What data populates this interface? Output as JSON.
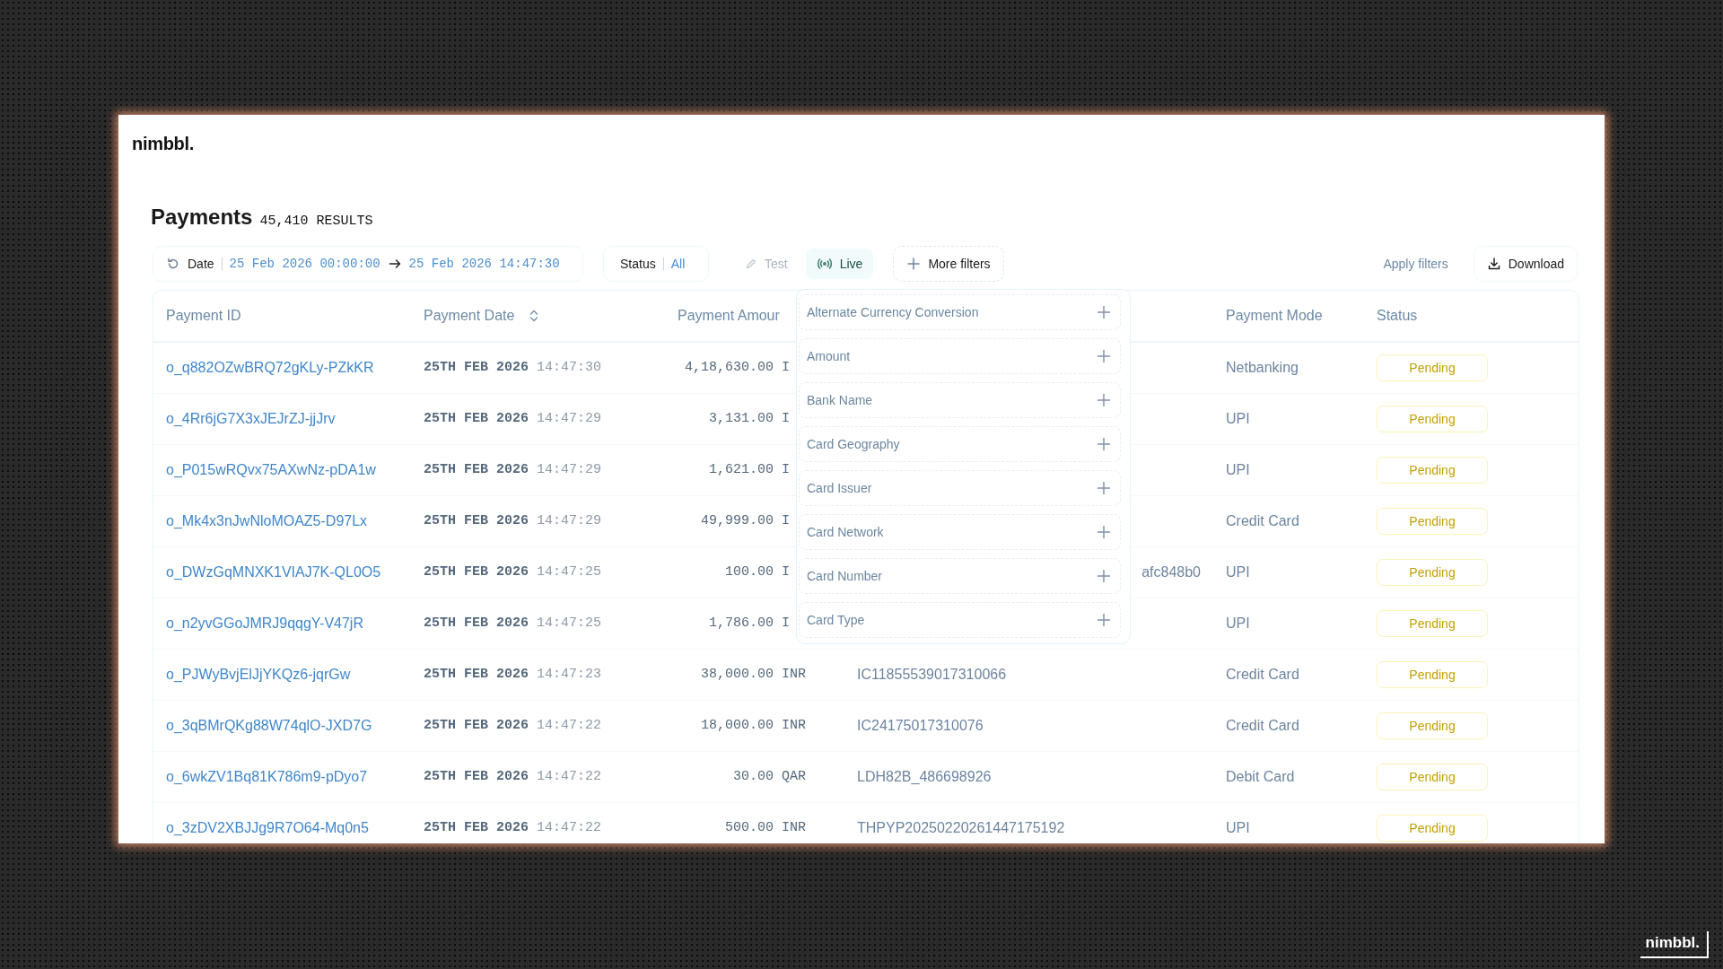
{
  "app": {
    "logo": "nimbbl."
  },
  "header": {
    "title": "Payments",
    "count": "45,410 RESULTS"
  },
  "filters": {
    "date": {
      "label": "Date",
      "from": "25 Feb 2026 00:00:00",
      "to": "25 Feb 2026 14:47:30"
    },
    "status": {
      "label": "Status",
      "value": "All"
    },
    "modes": [
      {
        "label": "Test",
        "kind": "test",
        "selected": false
      },
      {
        "label": "Live",
        "kind": "live",
        "selected": true
      }
    ],
    "more_filters": "More filters",
    "apply": "Apply filters",
    "download": "Download"
  },
  "table": {
    "columns": [
      {
        "label": "Payment ID",
        "sortable": false
      },
      {
        "label": "Payment Date",
        "sortable": true
      },
      {
        "label": "Payment Amour",
        "sortable": false
      },
      {
        "label": "Payment Mode",
        "sortable": false
      },
      {
        "label": "Status",
        "sortable": false
      }
    ],
    "rows": [
      {
        "payment_id": "o_q882OZwBRQ72gKLy-PZkKR",
        "date": "**25TH FEB 2026** 14:47:30",
        "amount": "4,18,630.00",
        "currency": "I",
        "mode": "Netbanking",
        "status": {
          "label": "Pending",
          "kind": "pending"
        }
      },
      {
        "payment_id": "o_4Rr6jG7X3xJEJrZJ-jjJrv",
        "date": "**25TH FEB 2026** 14:47:29",
        "amount": "3,131.00",
        "currency": "I",
        "mode": "UPI",
        "status": {
          "label": "Pending",
          "kind": "pending"
        }
      },
      {
        "payment_id": "o_P015wRQvx75AXwNz-pDA1w",
        "date": "**25TH FEB 2026** 14:47:29",
        "amount": "1,621.00",
        "currency": "I",
        "mode": "UPI",
        "status": {
          "label": "Pending",
          "kind": "pending"
        }
      },
      {
        "payment_id": "o_Mk4x3nJwNloMOAZ5-D97Lx",
        "date": "**25TH FEB 2026** 14:47:29",
        "amount": "49,999.00",
        "currency": "I",
        "mode": "Credit Card",
        "status": {
          "label": "Pending",
          "kind": "pending"
        }
      },
      {
        "payment_id": "o_DWzGqMNXK1VIAJ7K-QL0O5",
        "date": "**25TH FEB 2026** 14:47:25",
        "amount": "100.00",
        "currency": "I",
        "reference": "afc848b0",
        "reference_cut": true,
        "mode": "UPI",
        "status": {
          "label": "Pending",
          "kind": "pending"
        }
      },
      {
        "payment_id": "o_n2yvGGoJMRJ9qqgY-V47jR",
        "date": "**25TH FEB 2026** 14:47:25",
        "amount": "1,786.00",
        "currency": "I",
        "mode": "UPI",
        "status": {
          "label": "Pending",
          "kind": "pending"
        }
      },
      {
        "payment_id": "o_PJWyBvjElJjYKQz6-jqrGw",
        "date": "**25TH FEB 2026** 14:47:23",
        "amount": "38,000.00",
        "currency": "INR",
        "reference": "IC11855539017310066",
        "mode": "Credit Card",
        "status": {
          "label": "Pending",
          "kind": "pending"
        }
      },
      {
        "payment_id": "o_3qBMrQKg88W74qlO-JXD7G",
        "date": "**25TH FEB 2026** 14:47:22",
        "amount": "18,000.00",
        "currency": "INR",
        "reference": "IC24175017310076",
        "mode": "Credit Card",
        "status": {
          "label": "Pending",
          "kind": "pending"
        }
      },
      {
        "payment_id": "o_6wkZV1Bq81K786m9-pDyo7",
        "date": "**25TH FEB 2026** 14:47:22",
        "amount": "30.00",
        "currency": "QAR",
        "reference": "LDH82B_486698926",
        "mode": "Debit Card",
        "status": {
          "label": "Pending",
          "kind": "pending"
        }
      },
      {
        "payment_id": "o_3zDV2XBJJg9R7O64-Mq0n5",
        "date": "**25TH FEB 2026** 14:47:22",
        "amount": "500.00",
        "currency": "INR",
        "reference": "THPYP20250220261447175192",
        "mode": "UPI",
        "status": {
          "label": "Pending",
          "kind": "pending"
        }
      }
    ]
  },
  "filter_menu": {
    "items": [
      "Alternate Currency Conversion",
      "Amount",
      "Bank Name",
      "Card Geography",
      "Card Issuer",
      "Card Network",
      "Card Number",
      "Card Type"
    ]
  },
  "frame_logo": "nimbbl."
}
